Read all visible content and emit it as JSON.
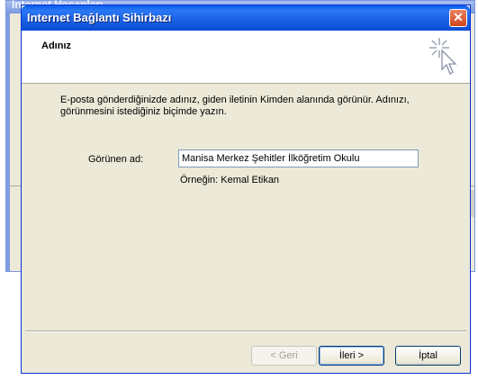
{
  "background_window": {
    "title": "Internet Hesapları"
  },
  "dialog": {
    "title": "Internet Bağlantı Sihirbazı",
    "close_label": "✕",
    "header_title": "Adınız",
    "description": "E-posta gönderdiğinizde adınız, giden iletinin Kimden alanında görünür. Adınızı, görünmesini istediğiniz biçimde yazın.",
    "display_name_label": "Görünen ad:",
    "display_name_value": "Manisa Merkez Şehitler İlköğretim Okulu",
    "example_text": "Örneğin: Kemal Etikan",
    "buttons": {
      "back": "< Geri",
      "next": "İleri >",
      "cancel": "İptal"
    },
    "header_icon": "wizard-wand-cursor-icon"
  },
  "colors": {
    "titlebar": "#0a5ce8",
    "dialog_bg": "#ece9d8",
    "close_button": "#d0451b"
  }
}
